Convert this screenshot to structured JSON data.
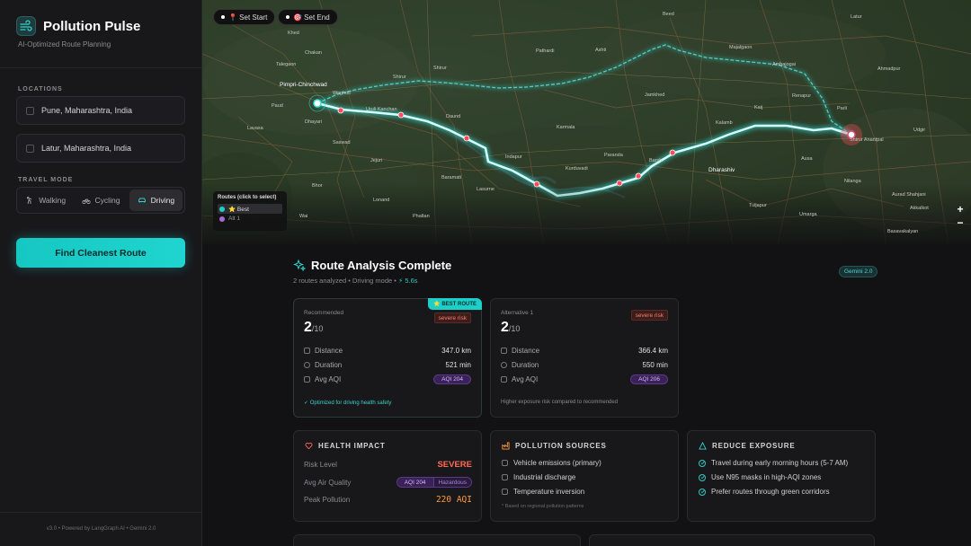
{
  "sidebar": {
    "title": "Pollution Pulse",
    "subtitle": "AI-Optimized Route Planning",
    "locations_label": "LOCATIONS",
    "start": "Pune, Maharashtra, India",
    "end": "Latur, Maharashtra, India",
    "travel_mode_label": "TRAVEL MODE",
    "modes": [
      {
        "label": "Walking",
        "icon": "walking-icon",
        "active": false
      },
      {
        "label": "Cycling",
        "icon": "bicycle-icon",
        "active": false
      },
      {
        "label": "Driving",
        "icon": "car-icon",
        "active": true
      }
    ],
    "find_button": "Find Cleanest Route",
    "footer": "v3.0 • Powered by LangGraph AI • Gemini 2.0"
  },
  "map": {
    "set_start": "📍 Set Start",
    "set_end": "🎯 Set End",
    "routes_title": "Routes (click to select)",
    "routes": [
      {
        "label": "⭐ Best",
        "color": "#1ccfc9"
      },
      {
        "label": "Alt 1",
        "color": "#a86ad6"
      }
    ],
    "zoom_in": "+",
    "zoom_out": "−",
    "places": {
      "p1": "Beed",
      "p2": "Pimpri-Chinchwad",
      "p3": "Ambajogai",
      "p4": "Latur",
      "p5": "Udgir",
      "p6": "Ahmadpur",
      "p7": "Dharashiv",
      "p8": "Barshi",
      "p9": "Baramati",
      "p10": "Daund",
      "p11": "Karmala",
      "p12": "Jamkhed",
      "p13": "Shirur Anantpal",
      "p14": "Ausa",
      "p15": "Nilanga",
      "p16": "Umarga",
      "p17": "Tuljapur",
      "p18": "Paranda",
      "p19": "Kurduvadi",
      "p20": "Indapur",
      "p21": "Lonand",
      "p22": "Phaltan",
      "p23": "Kalamb",
      "p24": "Renapur",
      "p25": "Shirur",
      "p26": "Pathardi",
      "p27": "Ashti",
      "p28": "Majalgaon",
      "p29": "Kaij",
      "p30": "Parli",
      "p31": "Lasurne",
      "p32": "Bhor",
      "p33": "Saswad",
      "p34": "Jejuri",
      "p35": "Lavasa",
      "p36": "Paud",
      "p37": "Talegaon",
      "p38": "Chakan",
      "p39": "Wagholi",
      "p40": "Uruli Kanchan",
      "p41": "Shirur",
      "p42": "Dhayari",
      "p43": "Khed",
      "p44": "Wai",
      "p45": "Akkalkot",
      "p46": "Basavakalyan",
      "p47": "Aurad Shahjani"
    }
  },
  "results": {
    "title": "Route Analysis Complete",
    "subtitle": "2 routes analyzed • Driving mode",
    "time": "⚡ 5.6s",
    "badge": "Gemini 2.0",
    "cards": [
      {
        "label": "Recommended",
        "best_tag": "⭐ BEST ROUTE",
        "risk": "severe risk",
        "score": "2",
        "score_max": "/10",
        "distance_label": "Distance",
        "distance": "347.0 km",
        "duration_label": "Duration",
        "duration": "521 min",
        "aqi_label": "Avg AQI",
        "aqi": "AQI 204",
        "footer": "✓ Optimized for driving health safety"
      },
      {
        "label": "Alternative 1",
        "risk": "severe risk",
        "score": "2",
        "score_max": "/10",
        "distance_label": "Distance",
        "distance": "366.4 km",
        "duration_label": "Duration",
        "duration": "550 min",
        "aqi_label": "Avg AQI",
        "aqi": "AQI 206",
        "footer": "Higher exposure risk compared to recommended"
      }
    ],
    "health": {
      "title": "HEALTH IMPACT",
      "risk_label": "Risk Level",
      "risk": "SEVERE",
      "aq_label": "Avg Air Quality",
      "aq_value": "AQI 204",
      "aq_category": "Hazardous",
      "peak_label": "Peak Pollution",
      "peak": "220 AQI"
    },
    "sources": {
      "title": "POLLUTION SOURCES",
      "items": [
        "Vehicle emissions (primary)",
        "Industrial discharge",
        "Temperature inversion"
      ],
      "note": "* Based on regional pollution patterns"
    },
    "reduce": {
      "title": "REDUCE EXPOSURE",
      "items": [
        "Travel during early morning hours (5-7 AM)",
        "Use N95 masks in high-AQI zones",
        "Prefer routes through green corridors"
      ]
    }
  }
}
